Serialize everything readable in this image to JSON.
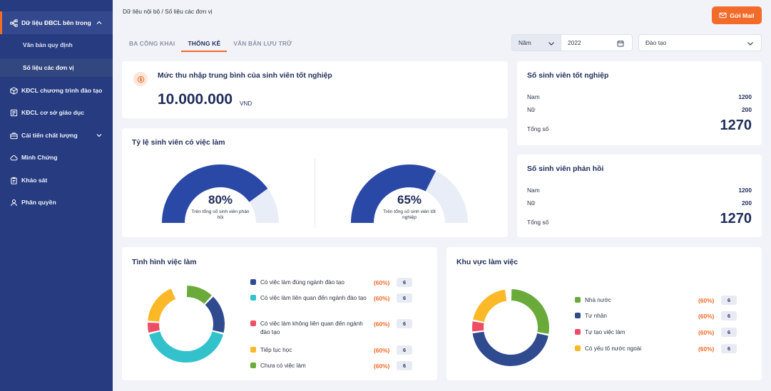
{
  "sidebar": {
    "section_active": "Dữ liệu ĐBCL bên trong",
    "sub_items": [
      "Văn bản quy định",
      "Số liệu các đơn vị"
    ],
    "items": [
      "KĐCL chương trình đào tạo",
      "KĐCL cơ sở giáo dục",
      "Cải tiến chất lượng",
      "Minh Chứng",
      "Khảo sát",
      "Phân quyền"
    ]
  },
  "header": {
    "breadcrumb": "Dữ liệu nội bộ / Số liệu các đơn vị",
    "mail_button": "Gửi Mail"
  },
  "tabs": [
    "BA CÔNG KHAI",
    "THỐNG KÊ",
    "VĂN BẢN LƯU TRỮ"
  ],
  "filters": {
    "period_type": "Năm",
    "year": "2022",
    "category": "Đào tạo"
  },
  "income": {
    "title": "Mức thu nhập trung bình của sinh viên tốt nghiệp",
    "value": "10.000.000",
    "unit": "VND"
  },
  "graduates": {
    "title": "Số sinh viên tốt nghiệp",
    "male_label": "Nam",
    "male_value": "1200",
    "female_label": "Nữ",
    "female_value": "200",
    "total_label": "Tổng số",
    "total_value": "1270"
  },
  "responders": {
    "title": "Số sinh viên phản hồi",
    "male_label": "Nam",
    "male_value": "1200",
    "female_label": "Nữ",
    "female_value": "200",
    "total_label": "Tổng số",
    "total_value": "1270"
  },
  "employment_rate": {
    "title": "Tỷ lệ sinh viên có việc làm",
    "gauges": [
      {
        "percent": 0.8,
        "label": "80%",
        "caption": "Trên tổng số sinh viên phản hồi"
      },
      {
        "percent": 0.65,
        "label": "65%",
        "caption": "Trên tổng số sinh viên tốt nghiệp"
      }
    ]
  },
  "job_situation": {
    "title": "Tình hình việc làm",
    "items": [
      {
        "label": "Có việc làm đúng ngành đào tạo",
        "pct": "(60%)",
        "count": "6",
        "color": "#2f4a8f",
        "share": 0.17
      },
      {
        "label": "Có việc làm liên quan đến ngành đào tạo",
        "pct": "(60%)",
        "count": "6",
        "color": "#33c2cc",
        "share": 0.42
      },
      {
        "label": "Có việc làm không liên quan đến ngành đào tạo",
        "pct": "(60%)",
        "count": "6",
        "color": "#ee4d64",
        "share": 0.05
      },
      {
        "label": "Tiếp tục học",
        "pct": "(60%)",
        "count": "6",
        "color": "#fbb827",
        "share": 0.18
      },
      {
        "label": "Chưa có việc làm",
        "pct": "(60%)",
        "count": "6",
        "color": "#6aaa3a",
        "share": 0.12
      }
    ]
  },
  "work_area": {
    "title": "Khu vực làm việc",
    "items": [
      {
        "label": "Nhà nước",
        "pct": "(60%)",
        "count": "6",
        "color": "#6aaa3a",
        "share": 0.28
      },
      {
        "label": "Tư nhân",
        "pct": "(60%)",
        "count": "6",
        "color": "#2f4a8f",
        "share": 0.45
      },
      {
        "label": "Tự tạo việc làm",
        "pct": "(60%)",
        "count": "6",
        "color": "#ee4d64",
        "share": 0.05
      },
      {
        "label": "Có yếu tố nước ngoài",
        "pct": "(60%)",
        "count": "6",
        "color": "#fbb827",
        "share": 0.2
      }
    ]
  }
}
